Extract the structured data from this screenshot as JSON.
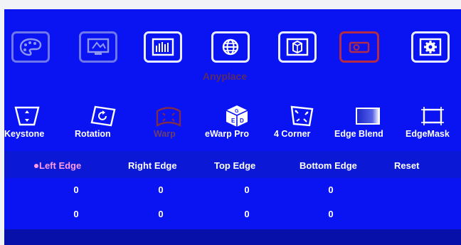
{
  "top_menu": {
    "items": [
      {
        "icon": "palette-icon"
      },
      {
        "icon": "display-settings-icon"
      },
      {
        "icon": "equalizer-icon"
      },
      {
        "icon": "globe-icon"
      },
      {
        "icon": "3d-icon"
      },
      {
        "icon": "projector-icon",
        "state": "active"
      },
      {
        "icon": "gear-icon"
      }
    ],
    "mode_title": "Anyplace"
  },
  "functions": [
    {
      "label": "Keystone",
      "icon": "keystone-icon"
    },
    {
      "label": "Rotation",
      "icon": "rotation-icon"
    },
    {
      "label": "Warp",
      "icon": "warp-icon",
      "disabled": true
    },
    {
      "label": "eWarp Pro",
      "icon": "ewarp-pro-icon"
    },
    {
      "label": "4 Corner",
      "icon": "four-corner-icon"
    },
    {
      "label": "Edge Blend",
      "icon": "edge-blend-icon"
    },
    {
      "label": "EdgeMask",
      "icon": "edge-mask-icon"
    }
  ],
  "edge_table": {
    "headers": [
      "Left Edge",
      "Right Edge",
      "Top Edge",
      "Bottom Edge",
      "Reset"
    ],
    "selected": "Left Edge",
    "rows": [
      [
        "0",
        "0",
        "0",
        "0"
      ],
      [
        "0",
        "0",
        "0",
        "0"
      ]
    ]
  },
  "colors": {
    "background": "#0a14f2",
    "selected_text": "#ff9de6",
    "active_icon_border": "#b42b47",
    "disabled_text": "#6a3e6e"
  }
}
